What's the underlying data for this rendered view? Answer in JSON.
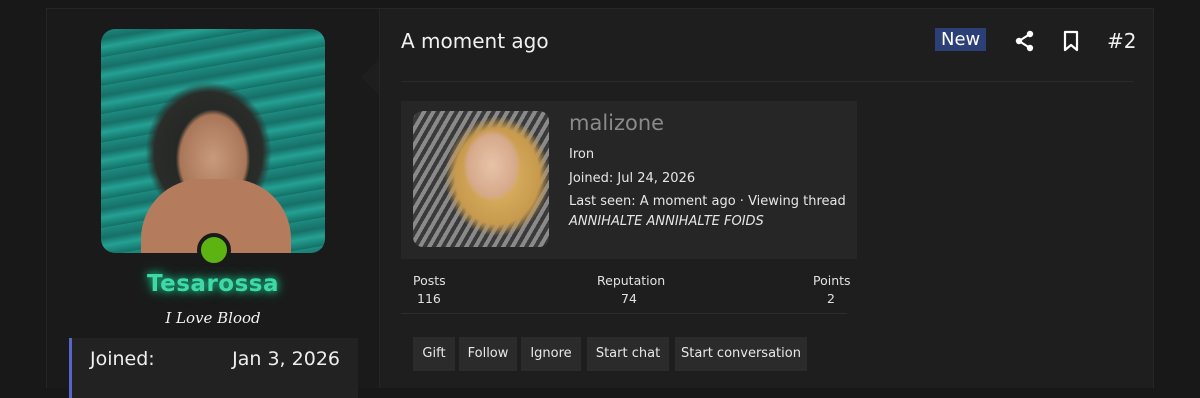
{
  "post": {
    "date": "A moment ago",
    "badge": "New",
    "number": "#2",
    "icons": {
      "share": "share-icon",
      "bookmark": "bookmark-icon"
    }
  },
  "author": {
    "username": "Tesarossa",
    "title": "I Love Blood",
    "online": true,
    "joined_label": "Joined:",
    "joined_value": "Jan 3, 2026"
  },
  "member_card": {
    "username": "malizone",
    "rank": "Iron",
    "joined": "Joined: Jul 24, 2026",
    "last_seen": "Last seen: A moment ago · Viewing thread",
    "signature": "ANNIHALTE ANNIHALTE FOIDS",
    "stats": [
      {
        "label": "Posts",
        "value": "116"
      },
      {
        "label": "Reputation",
        "value": "74"
      },
      {
        "label": "Points",
        "value": "2"
      }
    ],
    "actions": [
      "Gift",
      "Follow",
      "Ignore",
      "Start chat",
      "Start conversation"
    ]
  },
  "colors": {
    "username_glow": "#3fd9a8",
    "online_dot": "#5cb312",
    "badge_new_bg": "#2d3f77",
    "joined_border": "#5a63c8"
  }
}
